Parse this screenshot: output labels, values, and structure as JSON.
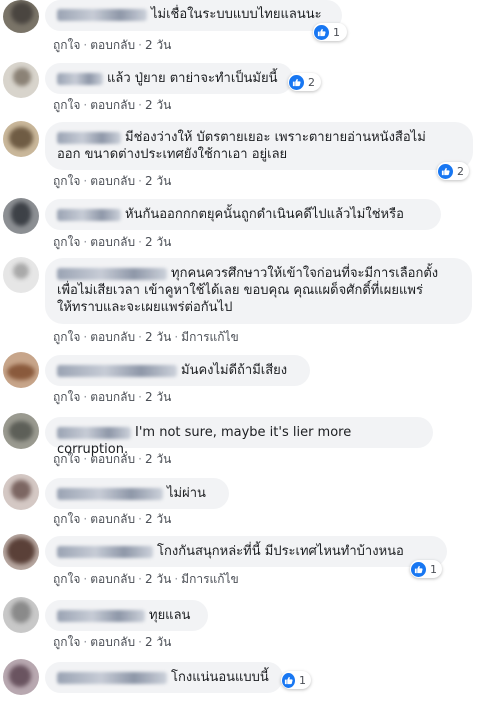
{
  "actions": {
    "like": "ถูกใจ",
    "reply": "ตอบกลับ",
    "sep": "·",
    "time": "2 วัน",
    "edited": "มีการแก้ไข"
  },
  "comments": [
    {
      "text": "ไม่เชื่อในระบบแบบไทยแลนนะ",
      "reactions": "1"
    },
    {
      "text": "แล้ว ปู่ยาย ตาย่าจะทำเป็นมัยนี้",
      "reactions": "2"
    },
    {
      "text_line1": "มีช่องว่างให้ บัตรตายเยอะ เพราะตายายอ่านหนังสือไม่",
      "text_line2": "ออก ขนาดต่างประเทศยังใช้กาเอา อยู่เลย",
      "reactions": "2"
    },
    {
      "text": "หันกันออกกกตยุคนั้นถูกดำเนินคดีไปแล้วไม่ใช่หรือ"
    },
    {
      "text_line1": "ทุกคนควรศึกษาวให้เข้าใจก่อนที่จะมีการเลือกตั้ง",
      "text_line2": "เพื่อไม่เสียเวลา เข้าคูหาใช้ได้เลย ขอบคุณ คุณแผด็จศักดิ์ที่เผยแพร่",
      "text_line3": "ให้ทราบและจะเผยแพร่ต่อกันไป"
    },
    {
      "text": "มันคงไม่ดีถ้ามีเสียง"
    },
    {
      "text": "I'm not sure, maybe it's lier more corruption."
    },
    {
      "text": "ไม่ผ่าน"
    },
    {
      "text": "โกงกันสนุกหล่ะที่นี้ มีประเทศไหนทำบ้างหนอ",
      "reactions": "1"
    },
    {
      "text": "ทุยแลน"
    },
    {
      "text": "โกงแน่นอนแบบนี้",
      "reactions": "1"
    }
  ],
  "icons": {
    "like": "like-thumb-icon"
  },
  "colors": {
    "accent": "#1877f2",
    "bubble": "#f2f3f5",
    "meta": "#4b4f56"
  }
}
